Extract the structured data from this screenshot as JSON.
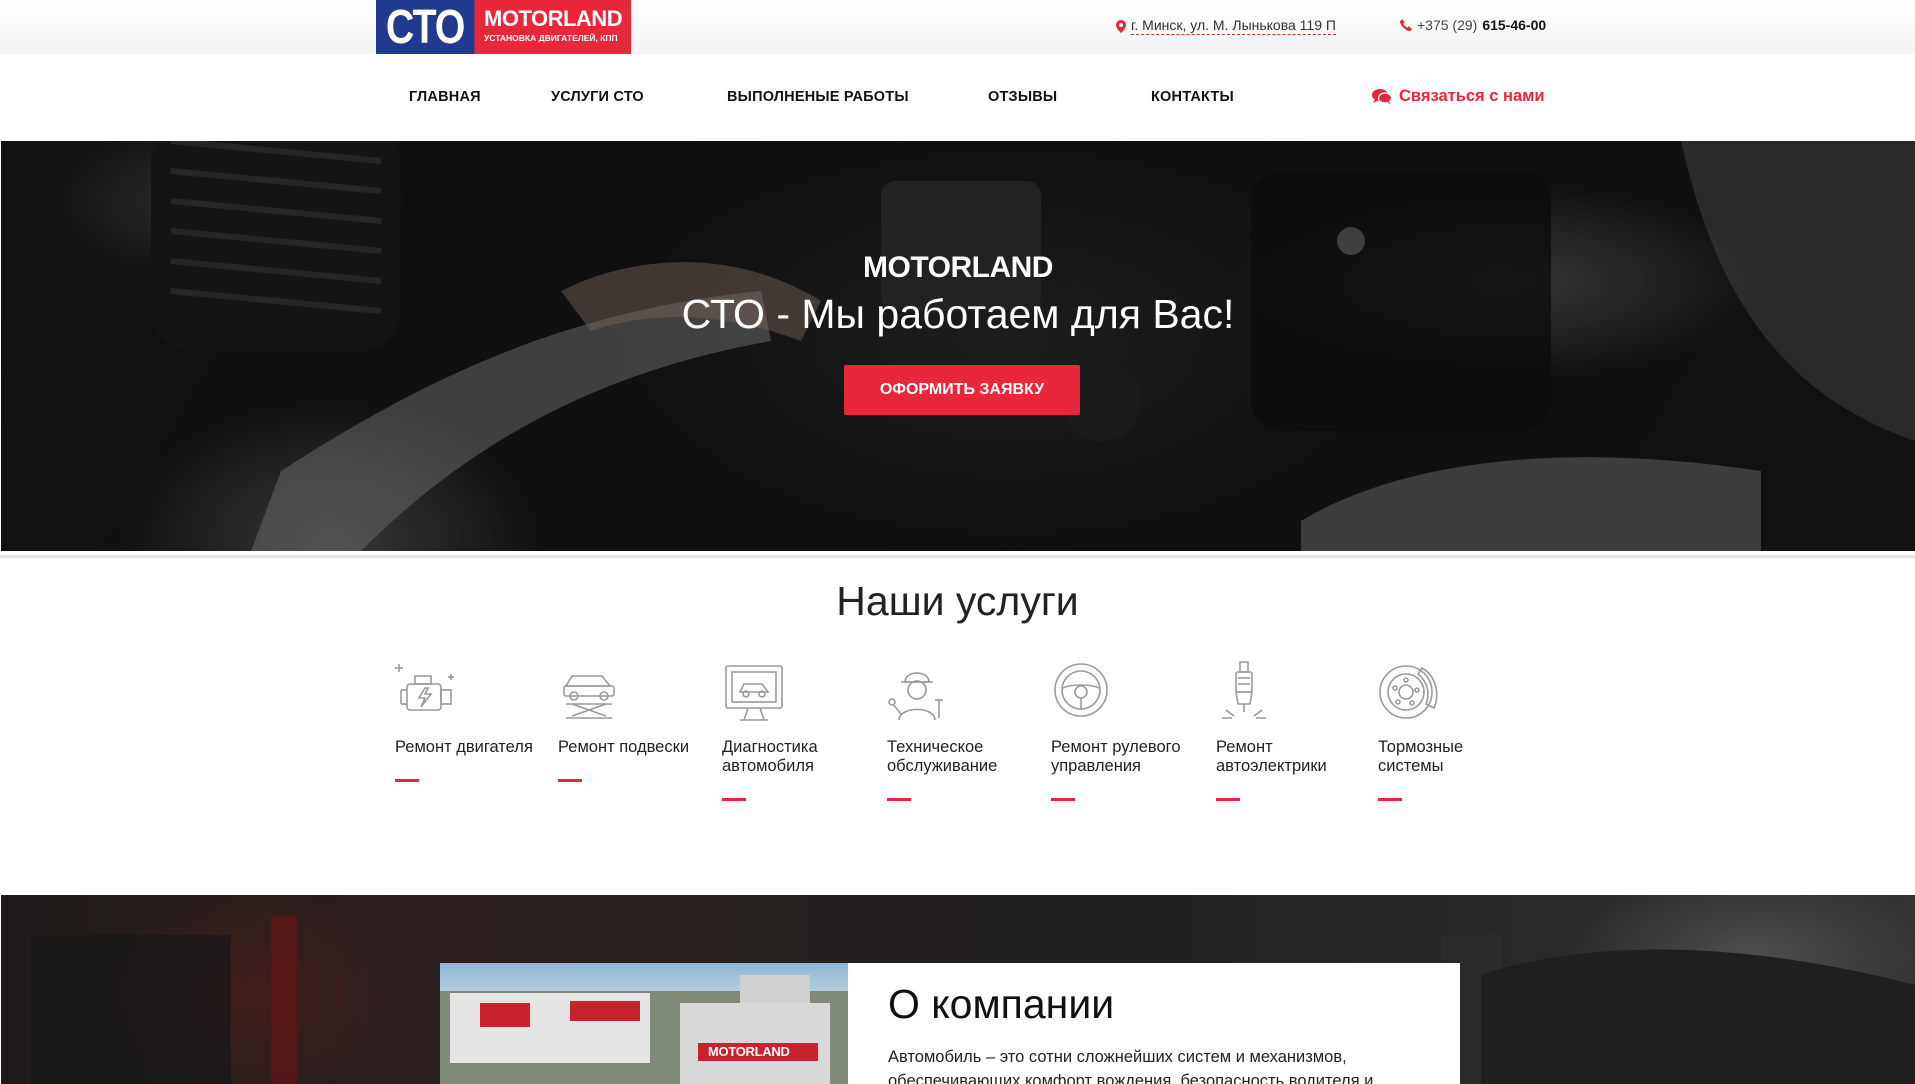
{
  "header": {
    "logo_sto": "СТО",
    "logo_brand": "MOTORLAND",
    "logo_tagline": "УСТАНОВКА ДВИГАТЕЛЕЙ, КПП",
    "address": "г. Минск, ул. М. Лынькова 119 П",
    "phone_prefix": "+375 (29)",
    "phone_number": "615-46-00"
  },
  "nav": {
    "items": [
      {
        "label": "ГЛАВНАЯ"
      },
      {
        "label": "УСЛУГИ СТО"
      },
      {
        "label": "ВЫПОЛНЕНЫЕ РАБОТЫ"
      },
      {
        "label": "ОТЗЫВЫ"
      },
      {
        "label": "КОНТАКТЫ"
      }
    ],
    "contact_label": "Связаться с нами"
  },
  "hero": {
    "brand": "MOTORLAND",
    "title": "СТО - Мы работаем для Вас!",
    "button_label": "ОФОРМИТЬ ЗАЯВКУ"
  },
  "services": {
    "title": "Наши услуги",
    "items": [
      {
        "label": "Ремонт двигателя",
        "icon": "engine-icon"
      },
      {
        "label": "Ремонт подвески",
        "icon": "car-lift-icon"
      },
      {
        "label": "Диагностика автомобиля",
        "icon": "diagnostics-monitor-icon"
      },
      {
        "label": "Техническое обслуживание",
        "icon": "mechanic-icon"
      },
      {
        "label": "Ремонт рулевого управления",
        "icon": "steering-wheel-icon"
      },
      {
        "label": "Ремонт автоэлектрики",
        "icon": "spark-plug-icon"
      },
      {
        "label": "Тормозные системы",
        "icon": "brake-disc-icon"
      }
    ]
  },
  "about": {
    "title": "О компании",
    "photo_sign": "MOTORLAND",
    "body": "Автомобиль – это сотни сложнейших систем и механизмов, обеспечивающих комфорт вождения, безопасность водителя и"
  },
  "colors": {
    "accent": "#e8273b",
    "logo_blue": "#1f3a8f"
  }
}
